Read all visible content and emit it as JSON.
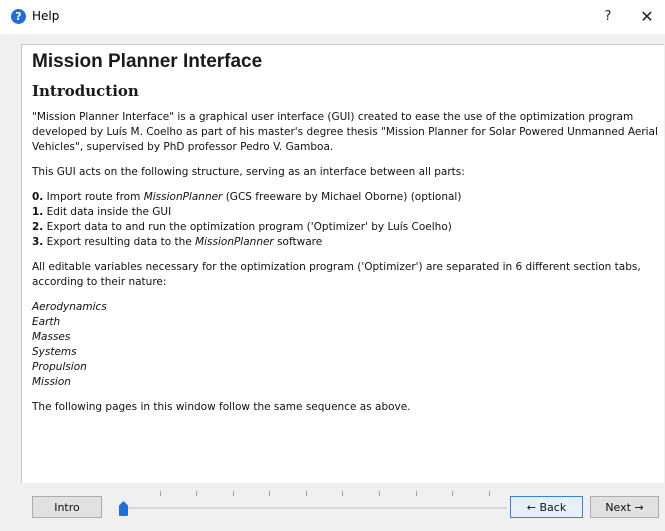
{
  "window": {
    "title": "Help",
    "help_btn": "?",
    "close_btn": "✕"
  },
  "content": {
    "heading": "Mission Planner Interface",
    "subheading": "Introduction",
    "intro_paragraph": "\"Mission Planner Interface\" is a graphical user interface (GUI) created to ease the use of the optimization program developed by Luís M. Coelho as part of his master's degree thesis \"Mission Planner for Solar Powered Unmanned Aerial Vehicles\", supervised by PhD professor Pedro V. Gamboa.",
    "structure_paragraph": "This GUI acts on the following structure, serving as an interface between all parts:",
    "steps": [
      {
        "num": "0.",
        "pre": " Import route from ",
        "em": "MissionPlanner",
        "post": " (GCS freeware by Michael Oborne) (optional)"
      },
      {
        "num": "1.",
        "pre": " Edit data inside the GUI",
        "em": "",
        "post": ""
      },
      {
        "num": "2.",
        "pre": " Export data to and run the optimization program ('Optimizer' by Luís Coelho)",
        "em": "",
        "post": ""
      },
      {
        "num": "3.",
        "pre": " Export resulting data to the ",
        "em": "MissionPlanner",
        "post": " software"
      }
    ],
    "sections_paragraph": "All editable variables necessary for the optimization program ('Optimizer') are separated in 6 different section tabs, according to their nature:",
    "sections": [
      "Aerodynamics",
      "Earth",
      "Masses",
      "Systems",
      "Propulsion",
      "Mission"
    ],
    "closing_paragraph": "The following pages in this window follow the same sequence as above."
  },
  "nav": {
    "intro_label": "Intro",
    "back_label": "← Back",
    "next_label": "Next →",
    "slider_position": 0,
    "slider_ticks": 10
  }
}
